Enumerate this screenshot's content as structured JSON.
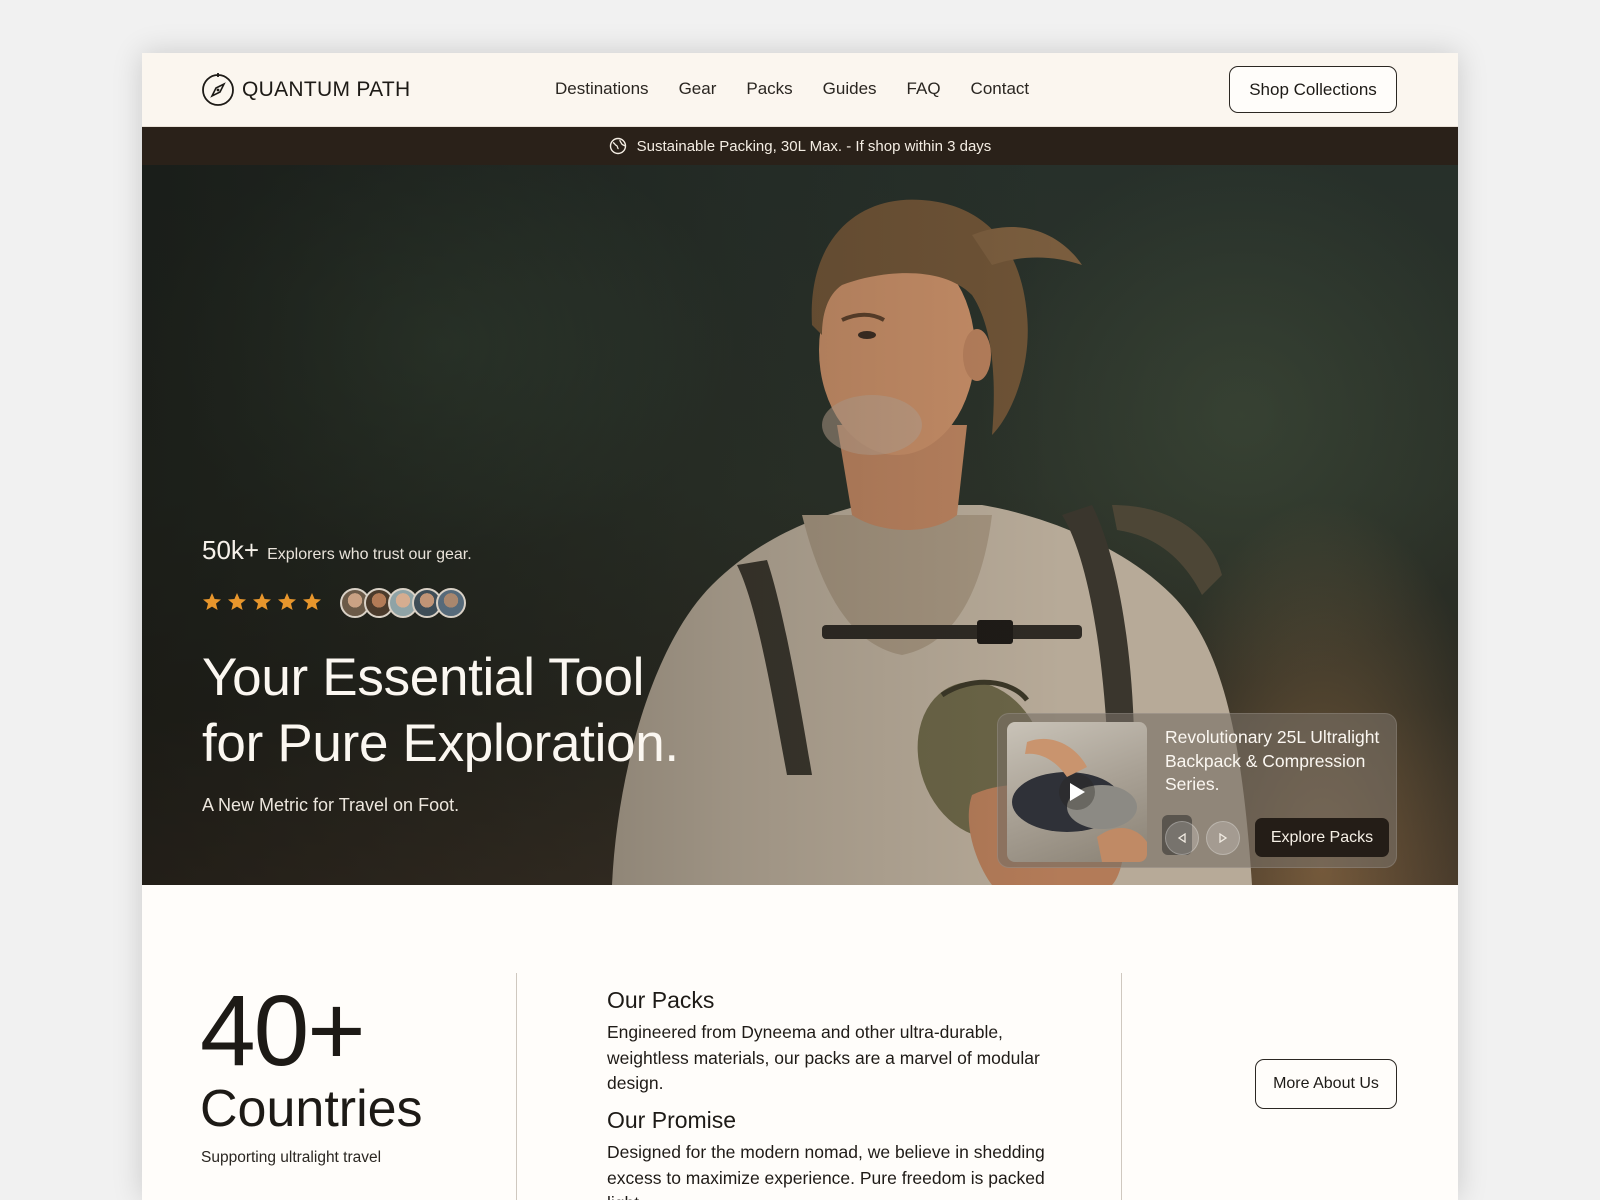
{
  "brand": {
    "name": "QUANTUM PATH",
    "logo_icon": "compass-icon"
  },
  "nav": {
    "items": [
      {
        "label": "Destinations"
      },
      {
        "label": "Gear"
      },
      {
        "label": "Packs"
      },
      {
        "label": "Guides"
      },
      {
        "label": "FAQ"
      },
      {
        "label": "Contact"
      }
    ],
    "cta_label": "Shop Collections"
  },
  "announcement": {
    "icon": "globe-icon",
    "text": "Sustainable Packing, 30L Max. - If shop within 3 days"
  },
  "hero": {
    "trust_count": "50k+",
    "trust_label": "Explorers who trust our gear.",
    "rating": 5,
    "headline_line1": "Your Essential Tool",
    "headline_line2": "for Pure Exploration.",
    "subheadline": "A New Metric for Travel on Foot.",
    "promo": {
      "title": "Revolutionary 25L Ultralight Backpack & Compression Series.",
      "cta_label": "Explore Packs"
    }
  },
  "stats": {
    "number": "40+",
    "word": "Countries",
    "caption": "Supporting ultralight travel"
  },
  "about": {
    "packs_title": "Our Packs",
    "packs_text": "Engineered from Dyneema and other ultra-durable, weightless materials, our packs are a marvel of modular design.",
    "promise_title": "Our Promise",
    "promise_text": "Designed for the modern nomad, we believe in shedding excess to maximize experience. Pure freedom is packed light.",
    "cta_label": "More About Us"
  },
  "colors": {
    "accent_dark": "#241d17",
    "header_bg": "#fbf6ef",
    "announcement_bg": "#2a2119",
    "star": "#e8962c"
  }
}
